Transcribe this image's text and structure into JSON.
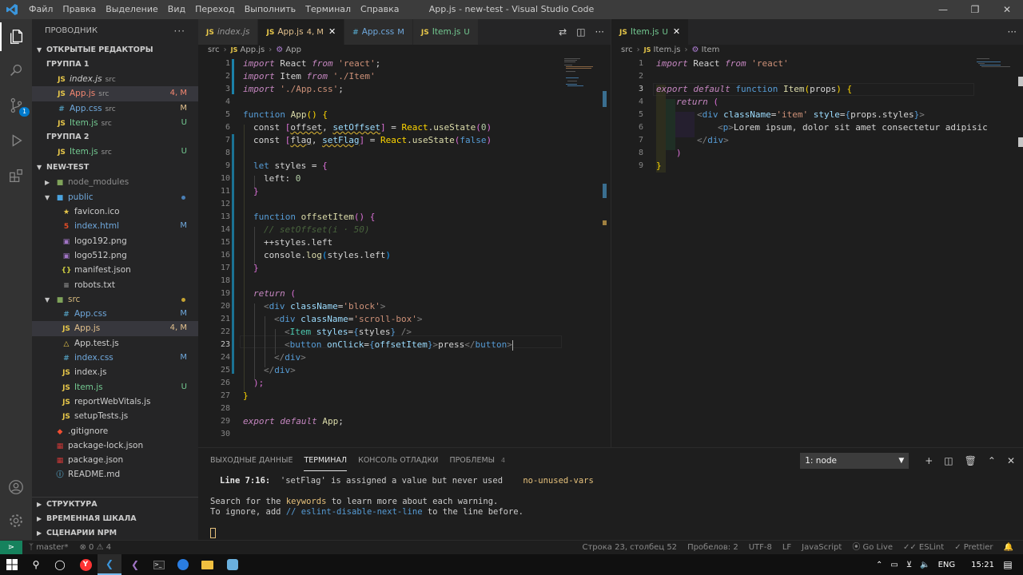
{
  "titlebar": {
    "title": "App.js - new-test - Visual Studio Code",
    "menu": [
      "Файл",
      "Правка",
      "Выделение",
      "Вид",
      "Переход",
      "Выполнить",
      "Терминал",
      "Справка"
    ]
  },
  "sidebar": {
    "title": "ПРОВОДНИК",
    "open_editors": {
      "label": "ОТКРЫТЫЕ РЕДАКТОРЫ",
      "badge": "1",
      "group1": "ГРУППА 1",
      "group2": "ГРУППА 2",
      "items1": [
        {
          "name": "index.js",
          "dir": "src",
          "status": "",
          "kind": "js"
        },
        {
          "name": "App.js",
          "dir": "src",
          "status": "4, M",
          "kind": "js"
        },
        {
          "name": "App.css",
          "dir": "src",
          "status": "M",
          "kind": "css"
        },
        {
          "name": "Item.js",
          "dir": "src",
          "status": "U",
          "kind": "js"
        }
      ],
      "items2": [
        {
          "name": "Item.js",
          "dir": "src",
          "status": "U",
          "kind": "js"
        }
      ]
    },
    "project": "NEW-TEST",
    "tree": [
      {
        "name": "node_modules",
        "status": ""
      },
      {
        "name": "public",
        "status": ""
      },
      {
        "name": "favicon.ico",
        "status": ""
      },
      {
        "name": "index.html",
        "status": "M"
      },
      {
        "name": "logo192.png",
        "status": ""
      },
      {
        "name": "logo512.png",
        "status": ""
      },
      {
        "name": "manifest.json",
        "status": ""
      },
      {
        "name": "robots.txt",
        "status": ""
      },
      {
        "name": "src",
        "status": ""
      },
      {
        "name": "App.css",
        "status": "M"
      },
      {
        "name": "App.js",
        "status": "4, M"
      },
      {
        "name": "App.test.js",
        "status": ""
      },
      {
        "name": "index.css",
        "status": "M"
      },
      {
        "name": "index.js",
        "status": ""
      },
      {
        "name": "Item.js",
        "status": "U"
      },
      {
        "name": "reportWebVitals.js",
        "status": ""
      },
      {
        "name": "setupTests.js",
        "status": ""
      },
      {
        "name": ".gitignore",
        "status": ""
      },
      {
        "name": "package-lock.json",
        "status": ""
      },
      {
        "name": "package.json",
        "status": ""
      },
      {
        "name": "README.md",
        "status": ""
      }
    ],
    "outline": "СТРУКТУРА",
    "timeline": "ВРЕМЕННАЯ ШКАЛА",
    "npm": "СЦЕНАРИИ NPM"
  },
  "editor1": {
    "tabs": [
      {
        "name": "index.js",
        "status": ""
      },
      {
        "name": "App.js",
        "status": "4, M"
      },
      {
        "name": "App.css",
        "status": "M"
      },
      {
        "name": "Item.js",
        "status": "U"
      }
    ],
    "crumb_dir": "src",
    "crumb_file": "App.js",
    "crumb_symbol": "App",
    "line_numbers": [
      "1",
      "2",
      "3",
      "4",
      "5",
      "6",
      "7",
      "8",
      "9",
      "10",
      "11",
      "12",
      "13",
      "14",
      "15",
      "16",
      "17",
      "18",
      "19",
      "20",
      "21",
      "22",
      "23",
      "24",
      "25",
      "26",
      "27",
      "28",
      "29",
      "30"
    ]
  },
  "editor2": {
    "tab": {
      "name": "Item.js",
      "status": "U"
    },
    "crumb_dir": "src",
    "crumb_file": "Item.js",
    "crumb_symbol": "Item",
    "line_numbers": [
      "1",
      "2",
      "3",
      "4",
      "5",
      "6",
      "7",
      "8",
      "9"
    ]
  },
  "code": {
    "l1": [
      "import",
      "React",
      "from",
      "'react'",
      ";"
    ],
    "l2": [
      "import",
      "Item",
      "from",
      "'./Item'"
    ],
    "l3": [
      "import",
      "'./App.css'",
      ";"
    ],
    "l5": [
      "function",
      "App",
      "() {"
    ],
    "l6": [
      "const",
      "[",
      "offset",
      ",",
      "setOffset",
      "]",
      "=",
      "React",
      ".",
      "useState",
      "(",
      "0",
      ")"
    ],
    "l7": [
      "const",
      "[",
      "flag",
      ",",
      "setFlag",
      "]",
      "=",
      "React",
      ".",
      "useState",
      "(",
      "false",
      ")"
    ],
    "l9": [
      "let",
      "styles",
      "=",
      "{"
    ],
    "l10": [
      "left",
      ":",
      "0"
    ],
    "l11": [
      "}"
    ],
    "l13": [
      "function",
      "offsetItem",
      "() {"
    ],
    "l14": "// setOffset(i · 50)",
    "l15": [
      "++",
      "styles",
      ".",
      "left"
    ],
    "l16": [
      "console",
      ".",
      "log",
      "(",
      "styles",
      ".",
      "left",
      ")"
    ],
    "l17": [
      "}"
    ],
    "l19": [
      "return",
      "("
    ],
    "l20": [
      "<",
      "div",
      "className",
      "=",
      "'block'",
      ">"
    ],
    "l21": [
      "<",
      "div",
      "className",
      "=",
      "'scroll-box'",
      ">"
    ],
    "l22": [
      "<",
      "Item",
      "styles",
      "=",
      "{",
      "styles",
      "}",
      " />"
    ],
    "l23": [
      "<",
      "button",
      "onClick",
      "=",
      "{",
      "offsetItem",
      "}",
      ">",
      "press",
      "</",
      "button",
      ">"
    ],
    "l24": [
      "</",
      "div",
      ">"
    ],
    "l25": [
      "</",
      "div",
      ">"
    ],
    "l26": [
      ");"
    ],
    "l27": [
      "}"
    ],
    "l29": [
      "export",
      "default",
      "App",
      ";"
    ]
  },
  "code2": {
    "l1": [
      "import",
      "React",
      "from",
      "'react'"
    ],
    "l3": [
      "export",
      "default",
      "function",
      "Item",
      "(",
      "props",
      ")",
      " {"
    ],
    "l4": [
      "return",
      "("
    ],
    "l5": [
      "<",
      "div",
      "className",
      "=",
      "'item'",
      "style",
      "=",
      "{",
      "props",
      ".",
      "styles",
      "}",
      ">"
    ],
    "l6": [
      "<",
      "p",
      ">",
      "Lorem ipsum, dolor sit amet consectetur adipisic"
    ],
    "l7": [
      "</",
      "div",
      ">"
    ],
    "l8": [
      ")"
    ],
    "l9": [
      "}"
    ]
  },
  "panel": {
    "tabs": [
      "ВЫХОДНЫЕ ДАННЫЕ",
      "ТЕРМИНАЛ",
      "КОНСОЛЬ ОТЛАДКИ",
      "ПРОБЛЕМЫ"
    ],
    "problems_count": "4",
    "terminal_select": "1: node",
    "line1_loc": "Line 7:16:",
    "line1_msg": "'setFlag' is assigned a value but never used",
    "line1_rule": "no-unused-vars",
    "line2_a": "Search for the ",
    "line2_kw": "keywords",
    "line2_b": " to learn more about each warning.",
    "line3_a": "To ignore, add ",
    "line3_kw": "// eslint-disable-next-line",
    "line3_b": " to the line before."
  },
  "status": {
    "branch": "master*",
    "errors": "0",
    "warnings": "4",
    "position": "Строка 23, столбец 52",
    "spaces": "Пробелов: 2",
    "encoding": "UTF-8",
    "eol": "LF",
    "language": "JavaScript",
    "golive": "Go Live",
    "eslint": "ESLint",
    "prettier": "Prettier"
  },
  "taskbar": {
    "lang": "ENG",
    "time": "15:21"
  },
  "colors": {
    "accent": "#007acc",
    "modified": "#e2c08d",
    "untracked": "#73c991",
    "error": "#f48771"
  }
}
